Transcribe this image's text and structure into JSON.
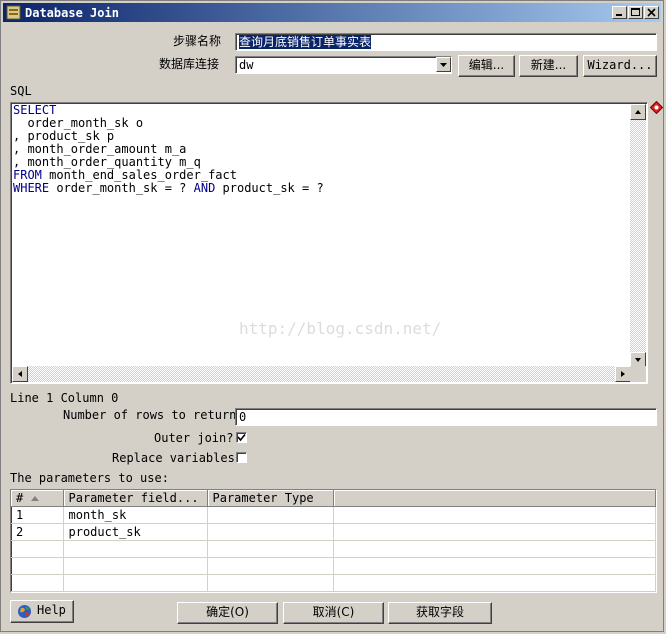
{
  "window": {
    "title": "Database Join"
  },
  "form": {
    "step_name_label": "步骤名称",
    "step_name_value": "查询月底销售订单事实表",
    "connection_label": "数据库连接",
    "connection_value": "dw",
    "edit_button": "编辑...",
    "new_button": "新建...",
    "wizard_button": "Wizard...",
    "sql_label": "SQL"
  },
  "sql": {
    "lines": [
      [
        {
          "t": "SELECT",
          "kw": true
        }
      ],
      [
        {
          "t": "  order_month_sk o",
          "kw": false
        }
      ],
      [
        {
          "t": ", product_sk p",
          "kw": false
        }
      ],
      [
        {
          "t": ", month_order_amount m_a",
          "kw": false
        }
      ],
      [
        {
          "t": ", month_order_quantity m_q",
          "kw": false
        }
      ],
      [
        {
          "t": "FROM",
          "kw": true
        },
        {
          "t": " month_end_sales_order_fact",
          "kw": false
        }
      ],
      [
        {
          "t": "WHERE",
          "kw": true
        },
        {
          "t": " order_month_sk = ? ",
          "kw": false
        },
        {
          "t": "AND",
          "kw": true
        },
        {
          "t": " product_sk = ?",
          "kw": false
        }
      ]
    ],
    "watermark": "http://blog.csdn.net/"
  },
  "status": {
    "position": "Line 1 Column 0"
  },
  "options": {
    "rows_label": "Number of rows to return",
    "rows_value": "0",
    "outer_join_label": "Outer join?",
    "outer_join_checked": true,
    "replace_vars_label": "Replace variables",
    "replace_vars_checked": false
  },
  "params": {
    "label": "The parameters to use:",
    "columns": [
      "#",
      "Parameter field...",
      "Parameter Type",
      ""
    ],
    "rows": [
      [
        "1",
        "month_sk",
        "",
        ""
      ],
      [
        "2",
        "product_sk",
        "",
        ""
      ],
      [
        "",
        "",
        "",
        ""
      ],
      [
        "",
        "",
        "",
        ""
      ],
      [
        "",
        "",
        "",
        ""
      ]
    ]
  },
  "buttons": {
    "help": "Help",
    "ok": "确定(O)",
    "cancel": "取消(C)",
    "get_fields": "获取字段"
  }
}
